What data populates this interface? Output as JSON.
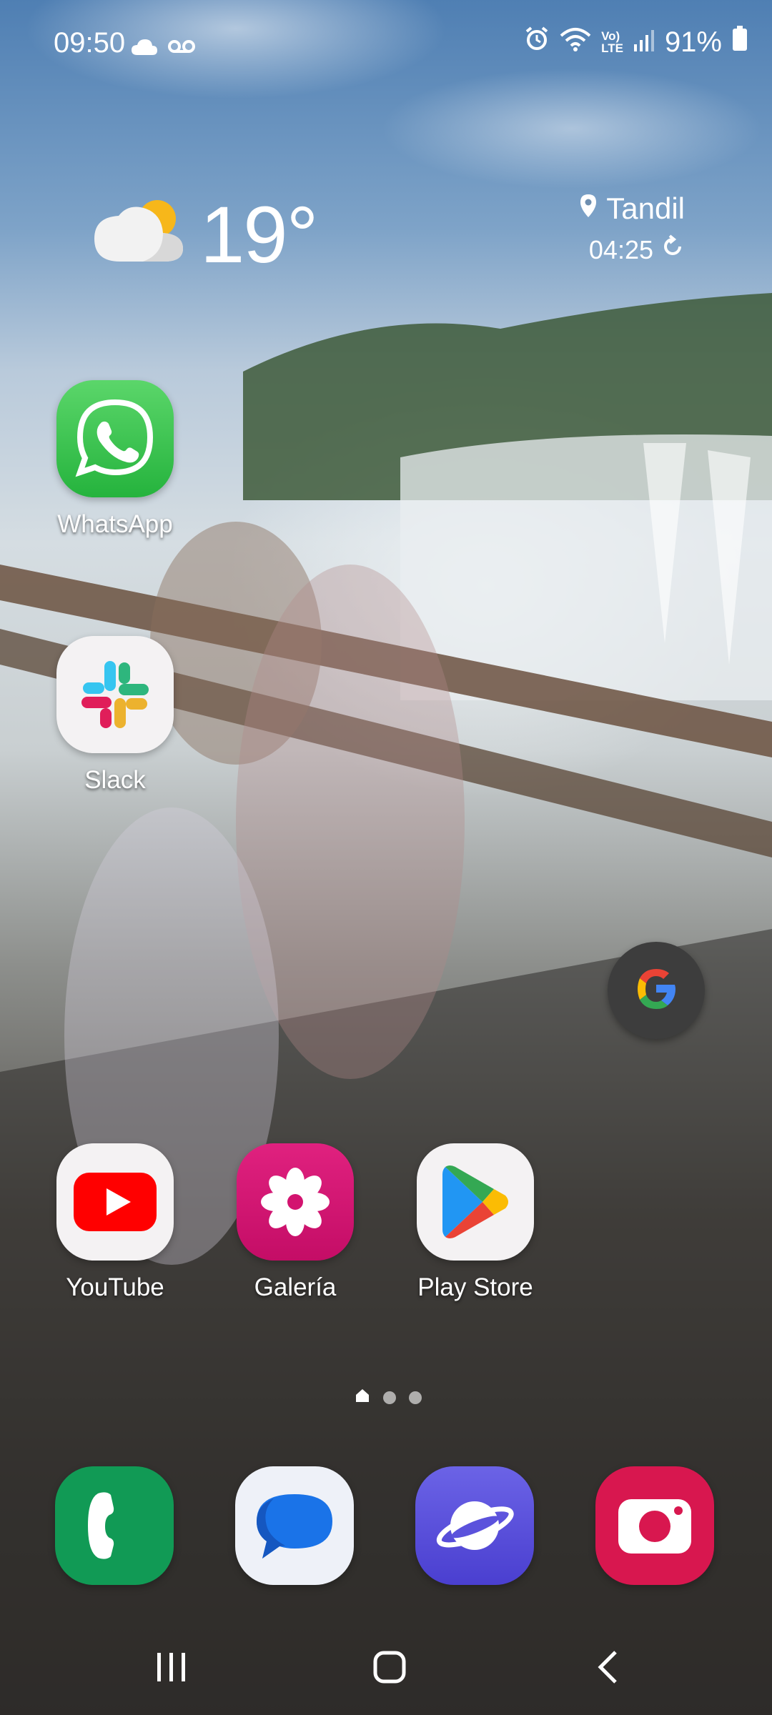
{
  "status_bar": {
    "time": "09:50",
    "battery": "91%",
    "network_label_top": "Vo)",
    "network_label_bottom": "LTE",
    "icons": [
      "cloud-icon",
      "voicemail-icon",
      "alarm-icon",
      "wifi-icon",
      "signal-icon",
      "battery-icon"
    ]
  },
  "weather": {
    "temperature": "19°",
    "location": "Tandil",
    "updated": "04:25",
    "icons": [
      "partly-cloudy-icon",
      "location-pin-icon",
      "refresh-icon"
    ]
  },
  "home_apps": [
    {
      "label": "WhatsApp"
    },
    {
      "label": "Slack"
    },
    {
      "label": "YouTube"
    },
    {
      "label": "Galería"
    },
    {
      "label": "Play Store"
    }
  ],
  "dock": [
    "phone-icon",
    "messages-icon",
    "internet-icon",
    "camera-icon"
  ],
  "google_widget": "google-icon",
  "pager": {
    "pages": 3,
    "current": 1
  },
  "nav_bar": [
    "recents-icon",
    "home-icon",
    "back-icon"
  ]
}
